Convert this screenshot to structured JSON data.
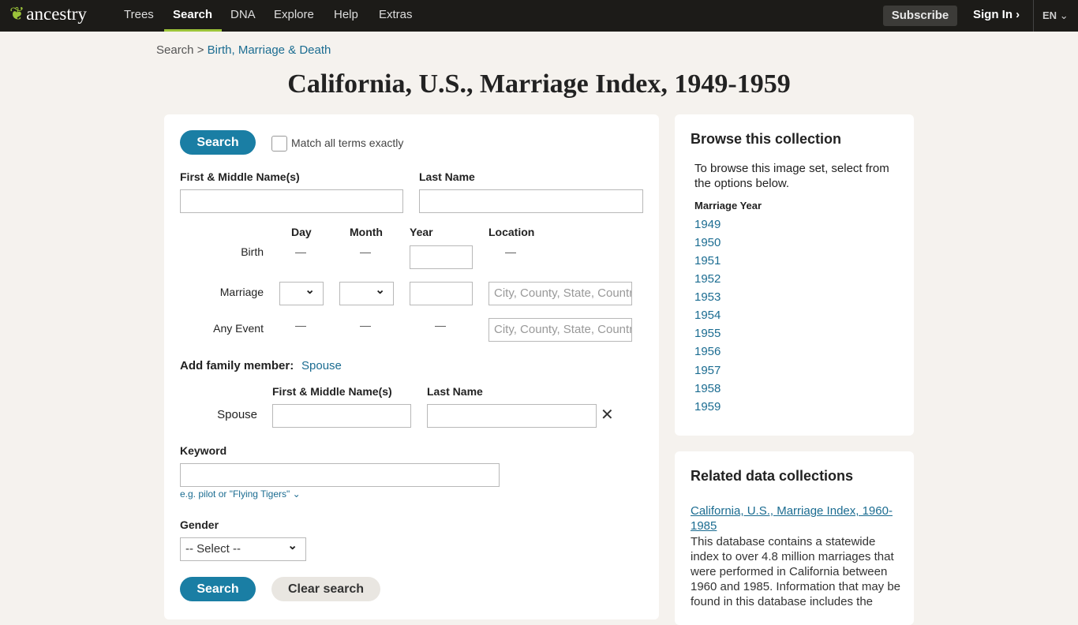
{
  "nav": {
    "logo": "ancestry",
    "items": [
      "Trees",
      "Search",
      "DNA",
      "Explore",
      "Help",
      "Extras"
    ],
    "active": "Search",
    "subscribe": "Subscribe",
    "signin": "Sign In",
    "lang": "EN"
  },
  "breadcrumb": {
    "root": "Search",
    "sep": ">",
    "current": "Birth, Marriage & Death"
  },
  "title": "California, U.S., Marriage Index, 1949-1959",
  "form": {
    "search": "Search",
    "match_exact": "Match all terms exactly",
    "match_checked": false,
    "first_name": "First & Middle Name(s)",
    "last_name": "Last Name",
    "cols": {
      "day": "Day",
      "month": "Month",
      "year": "Year",
      "location": "Location"
    },
    "rows": {
      "birth": "Birth",
      "marriage": "Marriage",
      "any": "Any Event"
    },
    "dash": "—",
    "location_placeholder": "City, County, State, Country",
    "add_family": "Add family member:",
    "spouse_link": "Spouse",
    "spouse_label": "Spouse",
    "spouse_first": "First & Middle Name(s)",
    "spouse_last": "Last Name",
    "keyword": "Keyword",
    "keyword_hint": "e.g. pilot or \"Flying Tigers\"",
    "gender": "Gender",
    "gender_value": "-- Select --",
    "clear": "Clear search"
  },
  "browse": {
    "title": "Browse this collection",
    "desc": "To browse this image set, select from the options below.",
    "field": "Marriage Year",
    "years": [
      "1949",
      "1950",
      "1951",
      "1952",
      "1953",
      "1954",
      "1955",
      "1956",
      "1957",
      "1958",
      "1959"
    ]
  },
  "related": {
    "title": "Related data collections",
    "link": "California, U.S., Marriage Index, 1960-1985",
    "desc": "This database contains a statewide index to over 4.8 million marriages that were performed in California between 1960 and 1985. Information that may be found in this database includes the"
  },
  "colors": {
    "nav": "#1c1b18",
    "accent": "#9cc43a",
    "button": "#1a7ea4",
    "link": "#1b6c91"
  }
}
